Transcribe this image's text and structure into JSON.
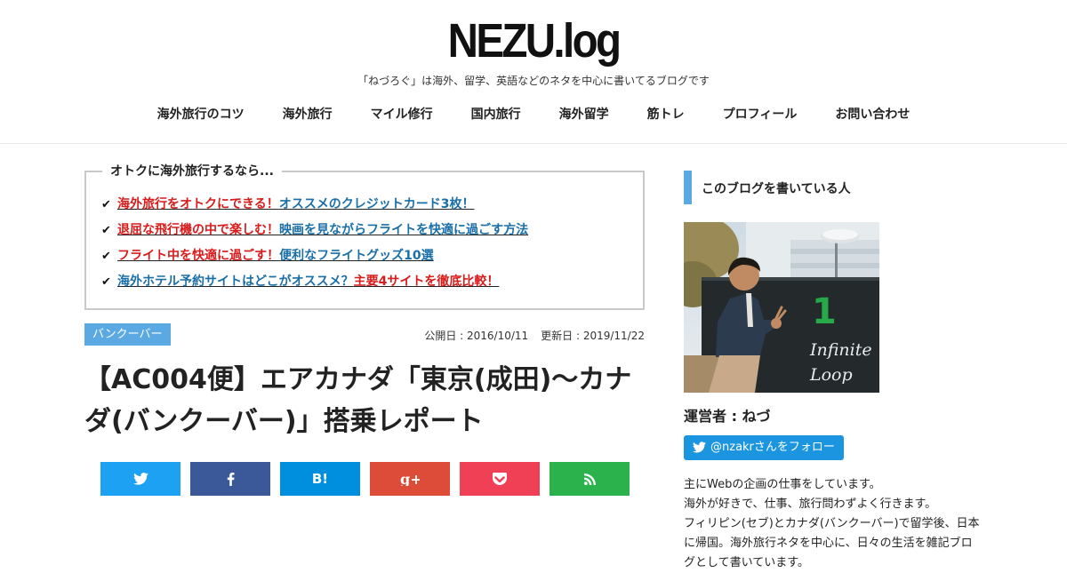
{
  "header": {
    "logo": "NEZU.log",
    "tagline": "「ねづろぐ」は海外、留学、英語などのネタを中心に書いてるブログです",
    "nav": [
      "海外旅行のコツ",
      "海外旅行",
      "マイル修行",
      "国内旅行",
      "海外留学",
      "筋トレ",
      "プロフィール",
      "お問い合わせ"
    ]
  },
  "recommend": {
    "title": "オトクに海外旅行するなら...",
    "items": [
      {
        "red": "海外旅行をオトクにできる！",
        "blue": "オススメのクレジットカード3枚！",
        "red2": ""
      },
      {
        "red": "退屈な飛行機の中で楽しむ！",
        "blue": "映画を見ながらフライトを快適に過ごす方法",
        "red2": ""
      },
      {
        "red": "フライト中を快適に過ごす！",
        "blue": "便利なフライトグッズ10選",
        "red2": ""
      },
      {
        "red": "",
        "blue": "海外ホテル予約サイトはどこがオススメ？",
        "red2": "主要4サイトを徹底比較！"
      }
    ]
  },
  "post": {
    "category": "バンクーバー",
    "published": "公開日 : 2016/10/11",
    "updated": "更新日 : 2019/11/22",
    "title": "【AC004便】エアカナダ「東京(成田)〜カナダ(バンクーバー)」搭乗レポート"
  },
  "share": {
    "hatena_label": "B!",
    "colors": {
      "twitter": "#1da1f2",
      "facebook": "#3b5998",
      "hatena": "#008fde",
      "googleplus": "#dd4b39",
      "pocket": "#ef4056",
      "feedly": "#2bb24c"
    }
  },
  "sidebar": {
    "heading": "このブログを書いている人",
    "accent": "#5ba9e2",
    "photo_sign_number": "1",
    "photo_sign_text": [
      "Infinite",
      "Loop"
    ],
    "operator": "運営者 : ねづ",
    "follow": "@nzakrさんをフォロー",
    "bio": [
      "主にWebの企画の仕事をしています。",
      "海外が好きで、仕事、旅行問わずよく行きます。",
      "フィリピン(セブ)とカナダ(バンクーバー)で留学後、日本",
      "に帰国。海外旅行ネタを中心に、日々の生活を雑記ブロ",
      "グとして書いています。"
    ]
  }
}
